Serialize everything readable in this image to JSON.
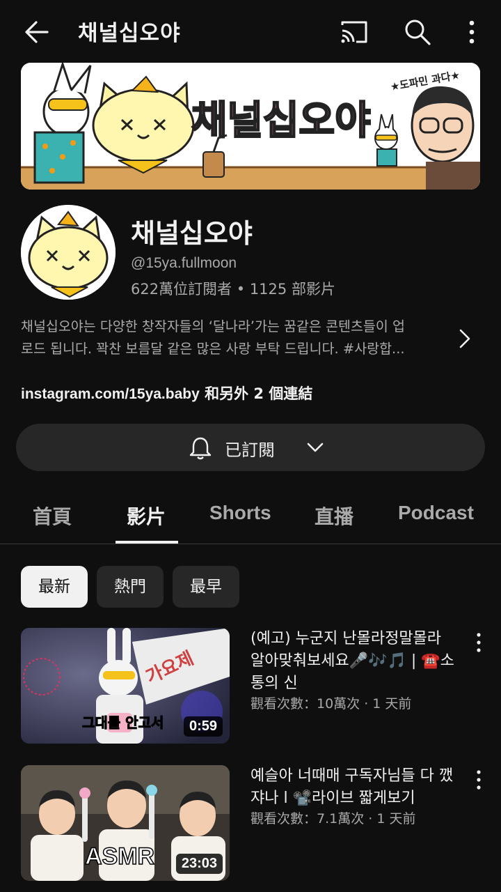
{
  "header": {
    "title": "채널십오야"
  },
  "banner": {
    "title_art": "채널십오야",
    "tagline_art": "★도파민 과다★"
  },
  "channel": {
    "name": "채널십오야",
    "handle": "@15ya.fullmoon",
    "stats": "622萬位訂閱者 • 1125 部影片",
    "description_line1": "채널십오야는 다양한 창작자들의 ‘달나라’가는 꿈같은 콘텐츠들이 업",
    "description_line2": "로드 됩니다. 꽉찬 보름달 같은 많은 사랑 부탁 드립니다. #사랑합...",
    "link_url": "instagram.com/15ya.baby",
    "link_more": " 和另外 2 個連結"
  },
  "subscribe": {
    "label": "已訂閱"
  },
  "tabs": [
    {
      "label": "首頁"
    },
    {
      "label": "影片"
    },
    {
      "label": "Shorts"
    },
    {
      "label": "直播"
    },
    {
      "label": "Podcast"
    }
  ],
  "active_tab": "影片",
  "chips": [
    {
      "label": "最新"
    },
    {
      "label": "熱門"
    },
    {
      "label": "最早"
    }
  ],
  "videos": [
    {
      "title": "(예고) 누군지 난몰라정말몰라 알아맞춰보세요🎤🎶🎵 | ☎️소통의 신",
      "meta": "觀看次數：10萬次 · 1 天前",
      "duration": "0:59",
      "caption": "그대를 안고서",
      "sign": "가요제"
    },
    {
      "title": "예슬아 너때매 구독자님들 다 깼쟈나 l 📽️라이브 짧게보기",
      "meta": "觀看次數：7.1萬次 · 1 天前",
      "duration": "23:03",
      "caption": "ASMR"
    }
  ],
  "colors": {
    "background": "#0f0f0f",
    "surface": "#272727",
    "text_primary": "#f1f1f1",
    "text_secondary": "#aaaaaa"
  }
}
